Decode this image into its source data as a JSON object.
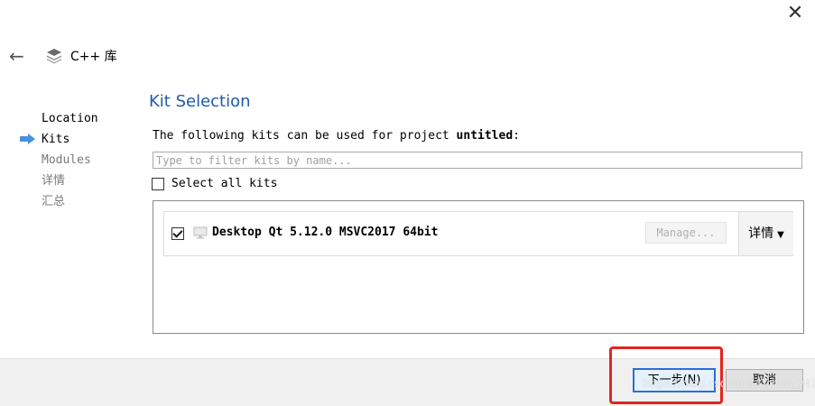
{
  "window": {
    "close_glyph": "✕"
  },
  "header": {
    "back_glyph": "←",
    "icon": "layers-icon",
    "title": "C++ 库"
  },
  "steps": [
    {
      "label": "Location",
      "state": "done"
    },
    {
      "label": "Kits",
      "state": "current"
    },
    {
      "label": "Modules",
      "state": "pending"
    },
    {
      "label": "详情",
      "state": "pending"
    },
    {
      "label": "汇总",
      "state": "pending"
    }
  ],
  "main": {
    "title": "Kit Selection",
    "intro_prefix": "The following kits can be used for project ",
    "project_name": "untitled",
    "intro_suffix": ":",
    "filter_placeholder": "Type to filter kits by name...",
    "filter_value": "",
    "select_all_label": "Select all kits",
    "select_all_checked": false
  },
  "kits": [
    {
      "checked": true,
      "icon": "monitor-icon",
      "name": "Desktop Qt 5.12.0 MSVC2017 64bit",
      "manage_label": "Manage...",
      "details_label": "详情",
      "details_caret": "▼"
    }
  ],
  "footer": {
    "next_label": "下一步(N)",
    "cancel_label": "取消"
  },
  "watermark": "https://blog.csdn.net/Cchen_y413",
  "colors": {
    "title": "#1f5aa8",
    "highlight": "#e42520",
    "step_arrow": "#4a90d9"
  }
}
